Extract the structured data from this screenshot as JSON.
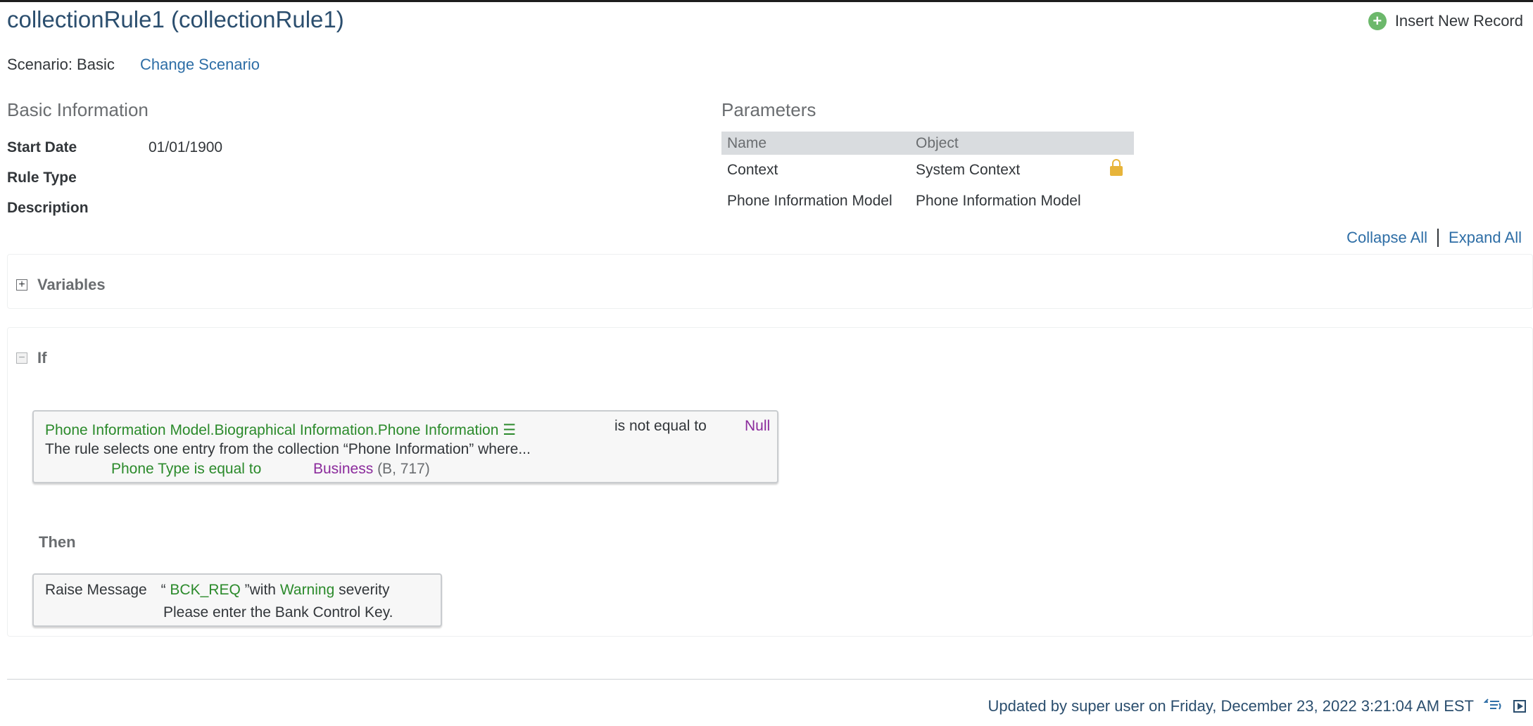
{
  "header": {
    "title": "collectionRule1 (collectionRule1)",
    "insert_label": "Insert New Record",
    "insert_icon": "plus-circle-icon"
  },
  "scenario": {
    "text": "Scenario: Basic",
    "change_label": "Change Scenario"
  },
  "basic_info": {
    "heading": "Basic Information",
    "fields": [
      {
        "label": "Start Date",
        "value": "01/01/1900"
      },
      {
        "label": "Rule Type",
        "value": ""
      },
      {
        "label": "Description",
        "value": ""
      }
    ]
  },
  "parameters": {
    "heading": "Parameters",
    "columns": [
      "Name",
      "Object"
    ],
    "rows": [
      {
        "name": "Context",
        "object": "System Context",
        "locked": true
      },
      {
        "name": "Phone Information Model",
        "object": "Phone Information Model",
        "locked": false
      }
    ]
  },
  "actions": {
    "collapse_all": "Collapse All",
    "expand_all": "Expand All"
  },
  "variables": {
    "title": "Variables",
    "toggle": "+"
  },
  "if_block": {
    "title": "If",
    "toggle": "−",
    "condition": {
      "field": "Phone Information Model.Biographical Information.Phone Information",
      "menu_icon": "☰",
      "operator": "is not equal to",
      "value": "Null",
      "description": "The rule selects one entry from the collection “Phone Information” where...",
      "sub_field": "Phone Type",
      "sub_operator": "is equal to",
      "sub_value": "Business",
      "sub_code": "(B, 717)"
    }
  },
  "then_block": {
    "title": "Then",
    "action": {
      "prefix": "Raise Message",
      "open_quote": "“",
      "message_key": "BCK_REQ",
      "close_quote": "”",
      "with_text": "with",
      "severity": "Warning",
      "severity_suffix": "severity",
      "message_text": "Please enter the Bank Control Key."
    }
  },
  "footer": {
    "updated": "Updated by super user on Friday, December 23, 2022 3:21:04 AM EST",
    "icons": [
      "history-icon",
      "play-icon"
    ]
  },
  "colors": {
    "title": "#2b4e6e",
    "link": "#2e6ea6",
    "green": "#2b8a2b",
    "purple": "#8b2b9c",
    "lock": "#e7b43a"
  }
}
